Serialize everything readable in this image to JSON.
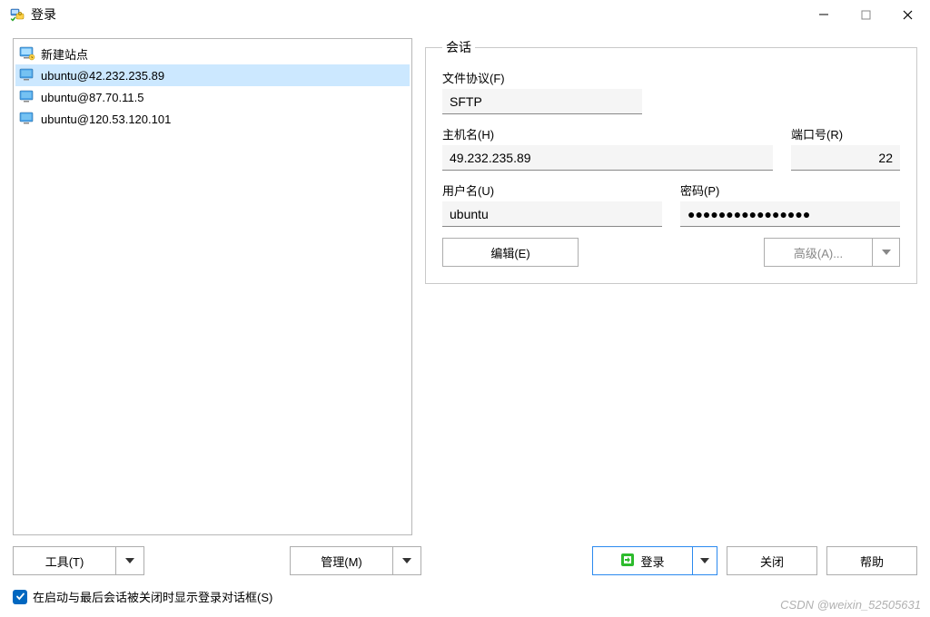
{
  "window": {
    "title": "登录"
  },
  "sites": {
    "root_label": "新建站点",
    "items": [
      {
        "label": "ubuntu@42.232.235.89",
        "selected": true
      },
      {
        "label": "ubuntu@87.70.11.5",
        "selected": false
      },
      {
        "label": "ubuntu@120.53.120.101",
        "selected": false
      }
    ]
  },
  "session": {
    "legend": "会话",
    "protocol_label": "文件协议(F)",
    "protocol_value": "SFTP",
    "host_label": "主机名(H)",
    "host_value": "49.232.235.89",
    "port_label": "端口号(R)",
    "port_value": "22",
    "user_label": "用户名(U)",
    "user_value": "ubuntu",
    "pass_label": "密码(P)",
    "pass_value": "●●●●●●●●●●●●●●●●",
    "edit_btn": "编辑(E)",
    "advanced_btn": "高级(A)..."
  },
  "toolbar": {
    "tools": "工具(T)",
    "manage": "管理(M)",
    "login": "登录",
    "close": "关闭",
    "help": "帮助"
  },
  "options": {
    "show_dialog_label": "在启动与最后会话被关闭时显示登录对话框(S)",
    "show_dialog_checked": true
  },
  "watermark": "CSDN @weixin_52505631"
}
